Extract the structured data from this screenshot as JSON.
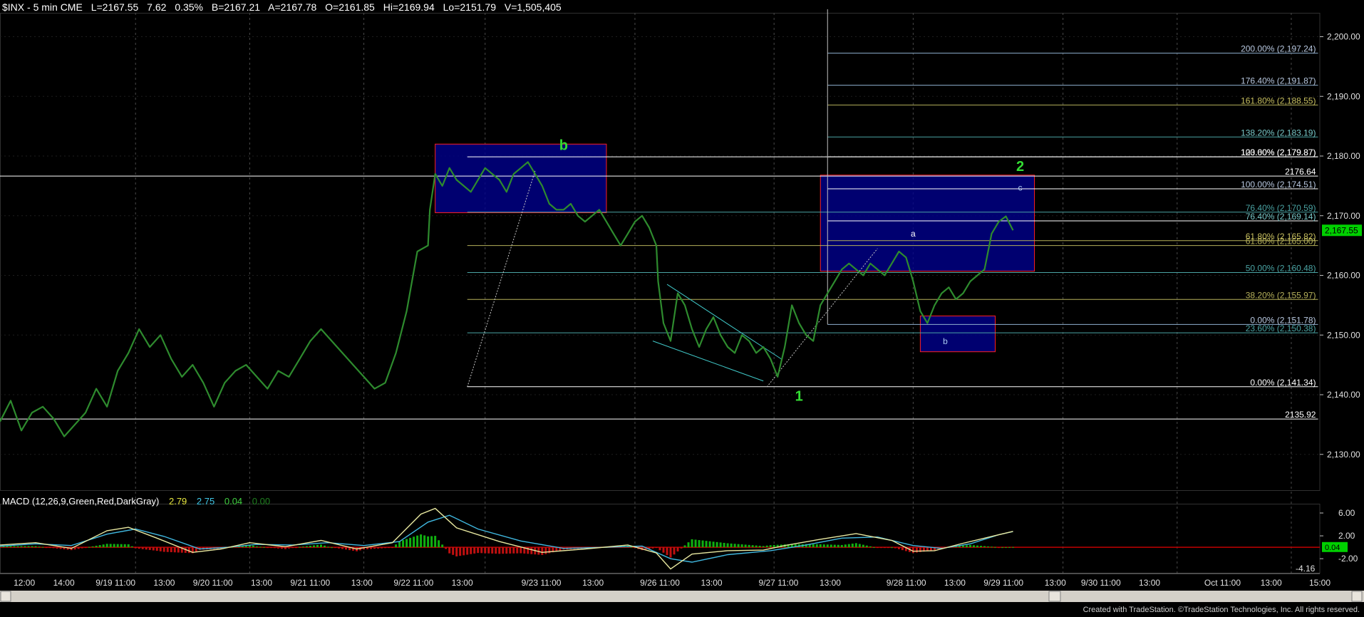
{
  "header": {
    "symbol": "$INX - 5 min  CME",
    "last": "L=2167.55",
    "change": "7.62",
    "change_pct": "0.35%",
    "bid": "B=2167.21",
    "ask": "A=2167.78",
    "open": "O=2161.85",
    "high": "Hi=2169.94",
    "low": "Lo=2151.79",
    "volume": "V=1,505,405"
  },
  "macd_header": {
    "label": "MACD (12,26,9,Green,Red,DarkGray)",
    "macd": "2.79",
    "signal": "2.75",
    "diff": "0.04",
    "zero": "0.00"
  },
  "credit": "Created with TradeStation. ©TradeStation Technologies, Inc. All rights reserved.",
  "colors": {
    "background": "#000000",
    "price": "#2e8b2e",
    "fib_white": "#ffffff",
    "fib_olive": "#b5b05a",
    "fib_teal": "#4aa3a3",
    "fib_steelblue": "#8fb0d0",
    "box_fill": "#000090",
    "box_border": "#ff2020",
    "wave_label": "#33dd33",
    "price_tag": "#00d000"
  },
  "chart_data": {
    "type": "line",
    "symbol": "$INX",
    "interval": "5 min",
    "ylim": [
      2124,
      2204
    ],
    "y_ticks": [
      "2,130.00",
      "2,140.00",
      "2,150.00",
      "2,160.00",
      "2,170.00",
      "2,180.00",
      "2,190.00",
      "2,200.00"
    ],
    "y_tick_values": [
      2130,
      2140,
      2150,
      2160,
      2170,
      2180,
      2190,
      2200
    ],
    "x_ticks": [
      "12:00",
      "14:00",
      "9/19 11:00",
      "13:00",
      "9/20 11:00",
      "13:00",
      "9/21 11:00",
      "13:00",
      "9/22 11:00",
      "13:00",
      "9/23 11:00",
      "13:00",
      "9/26 11:00",
      "13:00",
      "9/27 11:00",
      "13:00",
      "9/28 11:00",
      "13:00",
      "9/29 11:00",
      "13:00",
      "9/30 11:00",
      "13:00",
      "Oct 11:00",
      "13:00",
      "15:00"
    ],
    "day_separators": [
      "9/19",
      "9/20",
      "9/21",
      "9/22",
      "9/23",
      "9/26",
      "9/27",
      "9/28",
      "9/29",
      "9/30",
      "Oct"
    ],
    "last_price": "2,167.55",
    "price_path": [
      [
        0,
        2135.5
      ],
      [
        3,
        2139
      ],
      [
        6,
        2134
      ],
      [
        9,
        2137
      ],
      [
        12,
        2138
      ],
      [
        15,
        2136
      ],
      [
        18,
        2133
      ],
      [
        21,
        2135
      ],
      [
        24,
        2137
      ],
      [
        27,
        2141
      ],
      [
        30,
        2138
      ],
      [
        33,
        2144
      ],
      [
        36,
        2147
      ],
      [
        39,
        2151
      ],
      [
        42,
        2148
      ],
      [
        45,
        2150
      ],
      [
        48,
        2146
      ],
      [
        51,
        2143
      ],
      [
        54,
        2145
      ],
      [
        57,
        2142
      ],
      [
        60,
        2138
      ],
      [
        63,
        2142
      ],
      [
        66,
        2144
      ],
      [
        69,
        2145
      ],
      [
        72,
        2143
      ],
      [
        75,
        2141
      ],
      [
        78,
        2144
      ],
      [
        81,
        2143
      ],
      [
        84,
        2146
      ],
      [
        87,
        2149
      ],
      [
        90,
        2151
      ],
      [
        93,
        2149
      ],
      [
        96,
        2147
      ],
      [
        99,
        2145
      ],
      [
        102,
        2143
      ],
      [
        105,
        2141
      ],
      [
        108,
        2142
      ],
      [
        111,
        2147
      ],
      [
        114,
        2154
      ],
      [
        117,
        2164
      ],
      [
        120,
        2165
      ],
      [
        120.5,
        2171
      ],
      [
        122,
        2177
      ],
      [
        124,
        2175
      ],
      [
        126,
        2178
      ],
      [
        128,
        2176
      ],
      [
        130,
        2175
      ],
      [
        132,
        2174
      ],
      [
        134,
        2176
      ],
      [
        136,
        2178
      ],
      [
        138,
        2177
      ],
      [
        140,
        2176
      ],
      [
        142,
        2174
      ],
      [
        144,
        2177
      ],
      [
        146,
        2178
      ],
      [
        148,
        2179
      ],
      [
        150,
        2177
      ],
      [
        152,
        2175
      ],
      [
        154,
        2172
      ],
      [
        156,
        2171
      ],
      [
        158,
        2171
      ],
      [
        160,
        2172
      ],
      [
        162,
        2170
      ],
      [
        164,
        2169
      ],
      [
        166,
        2170
      ],
      [
        168,
        2171
      ],
      [
        170,
        2169
      ],
      [
        172,
        2167
      ],
      [
        174,
        2165
      ],
      [
        176,
        2167
      ],
      [
        178,
        2169
      ],
      [
        180,
        2170
      ],
      [
        182,
        2168
      ],
      [
        184,
        2165
      ],
      [
        184.5,
        2159
      ],
      [
        186,
        2152
      ],
      [
        188,
        2149
      ],
      [
        190,
        2157
      ],
      [
        192,
        2155
      ],
      [
        194,
        2151
      ],
      [
        196,
        2148
      ],
      [
        198,
        2151
      ],
      [
        200,
        2153
      ],
      [
        202,
        2150
      ],
      [
        204,
        2148
      ],
      [
        206,
        2147
      ],
      [
        208,
        2150
      ],
      [
        210,
        2149
      ],
      [
        212,
        2147
      ],
      [
        214,
        2148
      ],
      [
        216,
        2146
      ],
      [
        218,
        2143
      ],
      [
        220,
        2148
      ],
      [
        222,
        2155
      ],
      [
        224,
        2152
      ],
      [
        226,
        2150
      ],
      [
        228,
        2149
      ],
      [
        230,
        2155
      ],
      [
        232,
        2157
      ],
      [
        234,
        2159
      ],
      [
        236,
        2161
      ],
      [
        238,
        2162
      ],
      [
        240,
        2161
      ],
      [
        242,
        2160
      ],
      [
        244,
        2162
      ],
      [
        246,
        2161
      ],
      [
        248,
        2160
      ],
      [
        250,
        2162
      ],
      [
        252,
        2164
      ],
      [
        254,
        2163
      ],
      [
        256,
        2159
      ],
      [
        258,
        2154
      ],
      [
        260,
        2152
      ],
      [
        262,
        2155
      ],
      [
        264,
        2157
      ],
      [
        266,
        2158
      ],
      [
        268,
        2156
      ],
      [
        270,
        2157
      ],
      [
        272,
        2159
      ],
      [
        274,
        2160
      ],
      [
        276,
        2161
      ],
      [
        278,
        2167
      ],
      [
        280,
        2169
      ],
      [
        282,
        2169.9
      ],
      [
        284,
        2167.55
      ]
    ],
    "macd_ylim": [
      -4.6,
      7.0
    ],
    "macd_ticks": [
      "6.00",
      "2.00",
      "-2.00"
    ],
    "macd_tick_values": [
      6.0,
      2.0,
      -2.0
    ],
    "macd_current": "0.04",
    "macd_min": "-4.16",
    "macd_line": [
      [
        0,
        0.4
      ],
      [
        10,
        0.8
      ],
      [
        20,
        -0.2
      ],
      [
        30,
        2.9
      ],
      [
        36,
        3.5
      ],
      [
        44,
        1.6
      ],
      [
        54,
        -0.9
      ],
      [
        62,
        -0.3
      ],
      [
        70,
        0.8
      ],
      [
        80,
        0.1
      ],
      [
        90,
        1.2
      ],
      [
        100,
        -0.3
      ],
      [
        110,
        0.8
      ],
      [
        118,
        5.8
      ],
      [
        122,
        6.8
      ],
      [
        128,
        3.4
      ],
      [
        140,
        1.0
      ],
      [
        152,
        -0.9
      ],
      [
        164,
        -0.3
      ],
      [
        176,
        0.4
      ],
      [
        184,
        -1.0
      ],
      [
        188,
        -3.8
      ],
      [
        194,
        -1.2
      ],
      [
        204,
        -0.6
      ],
      [
        214,
        -0.5
      ],
      [
        220,
        0.3
      ],
      [
        230,
        1.4
      ],
      [
        240,
        2.4
      ],
      [
        250,
        1.2
      ],
      [
        256,
        -0.7
      ],
      [
        262,
        -0.6
      ],
      [
        270,
        0.7
      ],
      [
        278,
        1.9
      ],
      [
        284,
        2.79
      ]
    ],
    "signal_line": [
      [
        0,
        0.2
      ],
      [
        10,
        0.6
      ],
      [
        20,
        0.3
      ],
      [
        30,
        2.3
      ],
      [
        38,
        3.2
      ],
      [
        46,
        1.9
      ],
      [
        56,
        -0.3
      ],
      [
        64,
        0.0
      ],
      [
        72,
        0.5
      ],
      [
        82,
        0.4
      ],
      [
        92,
        0.8
      ],
      [
        102,
        0.3
      ],
      [
        112,
        1.0
      ],
      [
        120,
        4.4
      ],
      [
        126,
        5.6
      ],
      [
        134,
        3.2
      ],
      [
        146,
        1.1
      ],
      [
        158,
        -0.2
      ],
      [
        170,
        0.0
      ],
      [
        180,
        0.2
      ],
      [
        188,
        -2.0
      ],
      [
        194,
        -2.6
      ],
      [
        204,
        -1.3
      ],
      [
        216,
        -0.6
      ],
      [
        226,
        0.4
      ],
      [
        236,
        1.6
      ],
      [
        246,
        1.8
      ],
      [
        256,
        0.3
      ],
      [
        264,
        -0.2
      ],
      [
        272,
        0.6
      ],
      [
        280,
        2.2
      ],
      [
        284,
        2.75
      ]
    ],
    "fib_left": [
      {
        "label": "100.00% (2,179.87)",
        "value": 2179.87
      },
      {
        "label": "2176.64",
        "value": 2176.64
      },
      {
        "label": "76.40% (2,170.59)",
        "value": 2170.59
      },
      {
        "label": "61.80% (2,165.00)",
        "value": 2165.0
      },
      {
        "label": "50.00% (2,160.48)",
        "value": 2160.48
      },
      {
        "label": "38.20% (2,155.97)",
        "value": 2155.97
      },
      {
        "label": "23.60% (2,150.38)",
        "value": 2150.38
      },
      {
        "label": "0.00% (2,141.34)",
        "value": 2141.34
      },
      {
        "label": "2135.92",
        "value": 2135.92
      }
    ],
    "fib_right": [
      {
        "label": "200.00% (2,197.24)",
        "value": 2197.24
      },
      {
        "label": "176.40% (2,191.87)",
        "value": 2191.87
      },
      {
        "label": "161.80% (2,188.55)",
        "value": 2188.55
      },
      {
        "label": "138.20% (2,183.19)",
        "value": 2183.19
      },
      {
        "label": "123.60% (2,179.87)",
        "value": 2179.87
      },
      {
        "label": "100.00% (2,174.51)",
        "value": 2174.51
      },
      {
        "label": "76.40% (2,169.14)",
        "value": 2169.14
      },
      {
        "label": "61.80% (2,165.82)",
        "value": 2165.82
      },
      {
        "label": "0.00% (2,151.78)",
        "value": 2151.78
      }
    ],
    "boxes": [
      {
        "x0": 122,
        "x1": 170,
        "y0": 2170.5,
        "y1": 2182
      },
      {
        "x0": 230,
        "x1": 290,
        "y0": 2160.7,
        "y1": 2176.8
      },
      {
        "x0": 258,
        "x1": 279,
        "y0": 2147.2,
        "y1": 2153.2
      }
    ],
    "wave_labels": [
      {
        "text": "b",
        "x": 158,
        "y": 2181,
        "color": "green"
      },
      {
        "text": "1",
        "x": 224,
        "y": 2139,
        "color": "green"
      },
      {
        "text": "2",
        "x": 286,
        "y": 2177.5,
        "color": "green"
      },
      {
        "text": "c",
        "x": 286,
        "y": 2174.2,
        "color": "lightblue"
      },
      {
        "text": "a",
        "x": 256,
        "y": 2166.5,
        "color": "white"
      },
      {
        "text": "b",
        "x": 265,
        "y": 2148.5,
        "color": "lightblue"
      }
    ]
  }
}
